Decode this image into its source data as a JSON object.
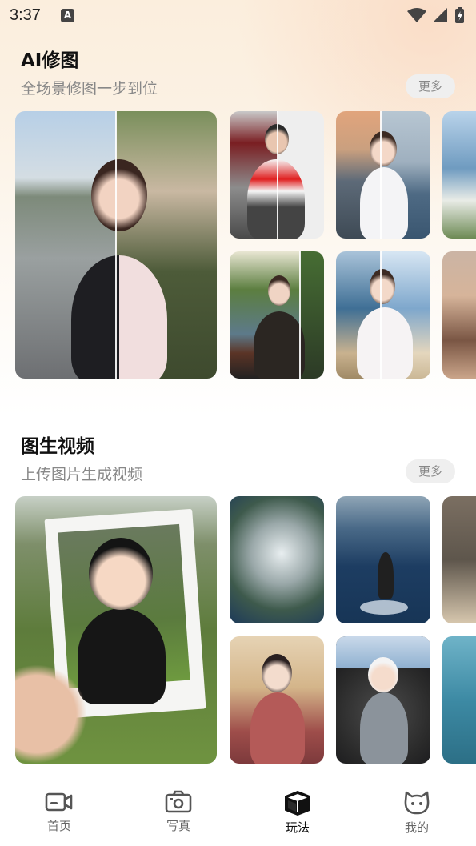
{
  "status_bar": {
    "time": "3:37",
    "notification_letter": "A"
  },
  "sections": [
    {
      "title": "AI修图",
      "subtitle": "全场景修图一步到位",
      "more_label": "更多"
    },
    {
      "title": "图生视频",
      "subtitle": "上传图片生成视频",
      "more_label": "更多"
    }
  ],
  "tabs": [
    {
      "label": "首页",
      "icon": "video-camera-icon"
    },
    {
      "label": "写真",
      "icon": "camera-icon"
    },
    {
      "label": "玩法",
      "icon": "cube-icon",
      "active": true
    },
    {
      "label": "我的",
      "icon": "cat-face-icon"
    }
  ],
  "colors": {
    "accent_active": "#111111",
    "inactive_tab": "#666666",
    "more_button_bg": "#efefef"
  }
}
